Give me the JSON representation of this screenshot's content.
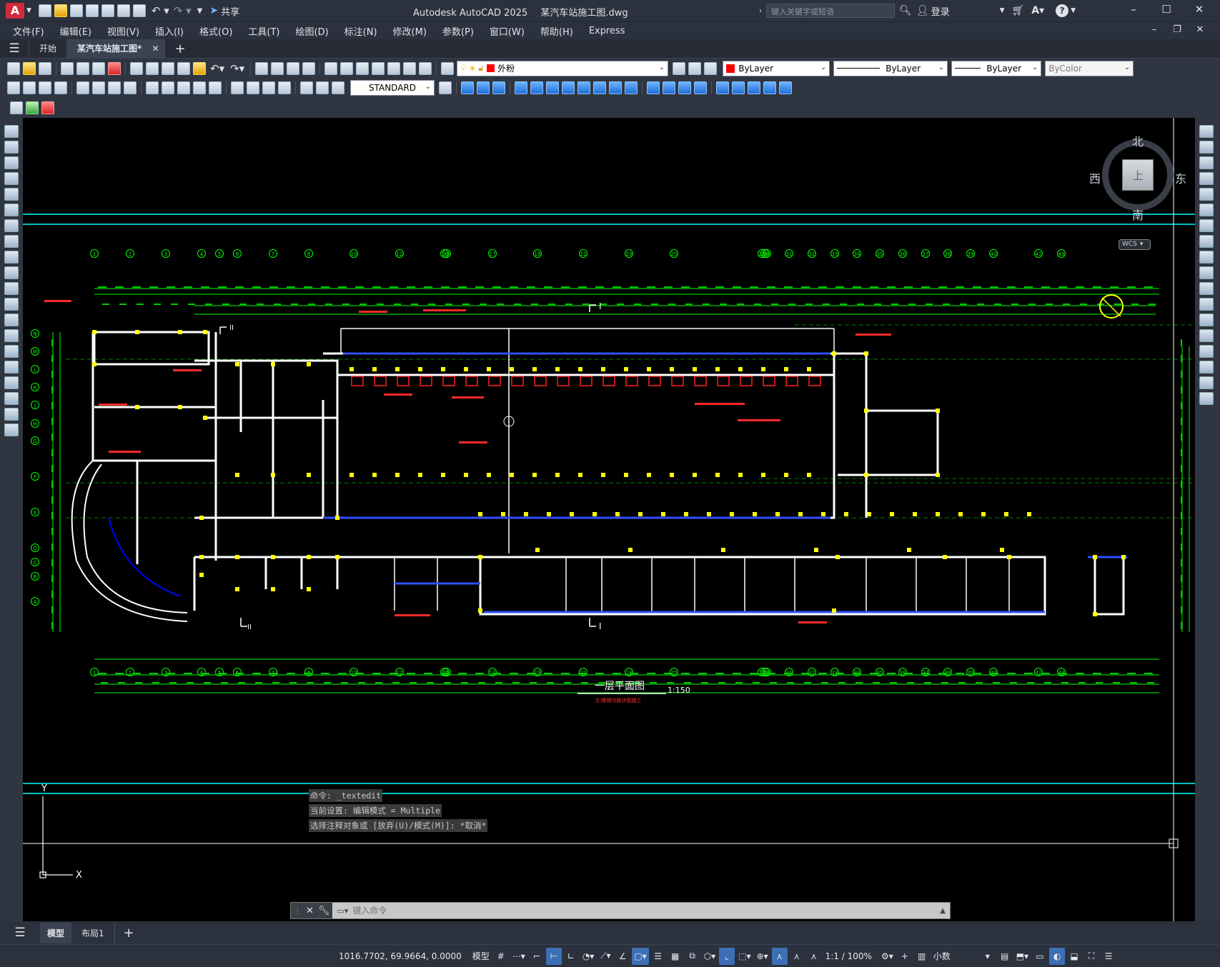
{
  "app": {
    "title": "Autodesk AutoCAD 2025",
    "filename": "某汽车站施工图.dwg",
    "logo": "A",
    "share": "共享",
    "search_placeholder": "键入关键字或短语",
    "login": "登录"
  },
  "menu": [
    "文件(F)",
    "编辑(E)",
    "视图(V)",
    "插入(I)",
    "格式(O)",
    "工具(T)",
    "绘图(D)",
    "标注(N)",
    "修改(M)",
    "参数(P)",
    "窗口(W)",
    "帮助(H)",
    "Express"
  ],
  "tabs": {
    "start": "开始",
    "active": "某汽车站施工图*"
  },
  "toolbar": {
    "layer": "外粉",
    "color": "ByLayer",
    "linetype": "ByLayer",
    "lineweight": "ByLayer",
    "plotstyle": "ByColor",
    "textstyle": "STANDARD"
  },
  "viewcube": {
    "north": "北",
    "south": "南",
    "east": "东",
    "west": "西",
    "top": "上",
    "wcs": "WCS"
  },
  "drawing": {
    "title": "一层平面图",
    "scale": "1:150",
    "subtitle": "注:楼梯均按详图施工",
    "section_top": "I",
    "section_bottom": "I",
    "section_left_top": "II",
    "section_left_bottom": "II",
    "axes_x": [
      "1",
      "2",
      "3",
      "4",
      "5",
      "6",
      "7",
      "8",
      "10",
      "12",
      "14",
      "15",
      "17",
      "19",
      "21",
      "23",
      "25",
      "28",
      "29",
      "30",
      "31",
      "32",
      "33",
      "34",
      "35",
      "36",
      "37",
      "38",
      "39",
      "40",
      "42",
      "43"
    ],
    "axes_y": [
      "N",
      "M",
      "L",
      "K",
      "J",
      "H",
      "G",
      "F",
      "E",
      "D",
      "C",
      "B",
      "A"
    ]
  },
  "command": {
    "lines": [
      "命令: _textedit",
      "当前设置: 编辑模式 = Multiple",
      "选择注释对象或 [放弃(U)/模式(M)]: *取消*"
    ],
    "placeholder": "键入命令"
  },
  "layouts": {
    "model": "模型",
    "layout1": "布局1"
  },
  "status": {
    "coords": "1016.7702, 69.9664, 0.0000",
    "model": "模型",
    "scale": "1:1 / 100%",
    "units": "小数"
  },
  "ucs": {
    "x": "X",
    "y": "Y"
  }
}
